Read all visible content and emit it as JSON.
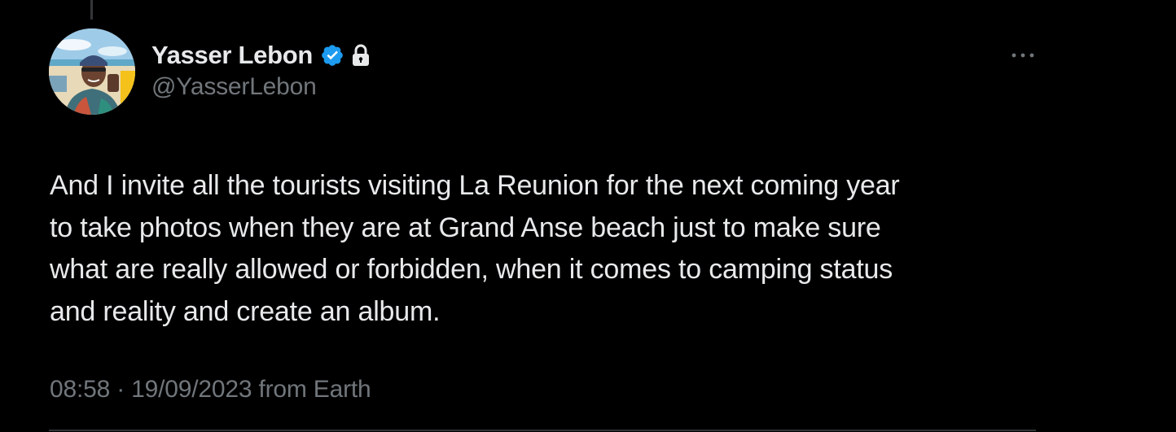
{
  "author": {
    "display_name": "Yasser Lebon",
    "handle": "@YasserLebon",
    "verified": true,
    "protected": true,
    "avatar_icon": "avatar-photo-beach"
  },
  "tweet": {
    "text_lines": [
      "And I invite all the tourists visiting La Reunion for the next coming year",
      "to take photos when they are at Grand Anse beach just to make sure",
      "what are really allowed or forbidden, when it comes to camping status",
      "and reality and create an album."
    ],
    "time": "08:58",
    "separator": "·",
    "date": "19/09/2023",
    "source": "from Earth"
  },
  "icons": {
    "verified": "verified-badge-icon",
    "lock": "lock-icon",
    "more": "more-horizontal-icon"
  },
  "colors": {
    "background": "#000000",
    "text_primary": "#e7e9ea",
    "text_secondary": "#71767b",
    "verified_blue": "#1d9bf0"
  }
}
